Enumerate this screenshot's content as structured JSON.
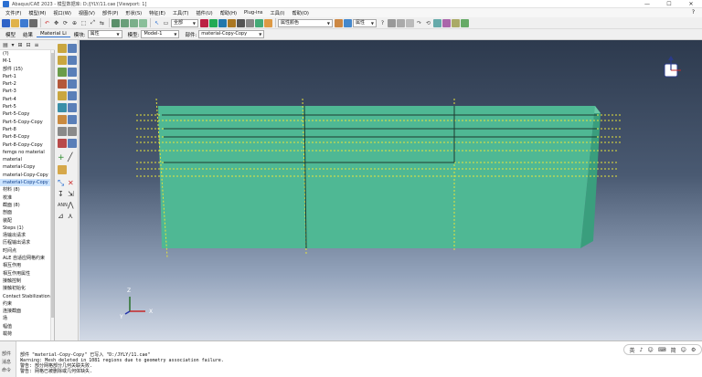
{
  "window": {
    "title": "Abaqus/CAE 2023 - 模型数据库: D:/JYLY/11.cae [Viewport: 1]",
    "controls": [
      "—",
      "☐",
      "✕"
    ]
  },
  "menubar": {
    "items": [
      "文件(F)",
      "模型(M)",
      "视口(W)",
      "视图(V)",
      "部件(P)",
      "形状(S)",
      "特征(E)",
      "工具(T)",
      "插件(U)",
      "帮助(H)",
      "Plug-ins",
      "工具(I)",
      "帮助(O)"
    ],
    "submenu_indicator": "?"
  },
  "toolbar1": {
    "render_combo": "全部",
    "render_combo2": "属性颜色",
    "combo3": "属性"
  },
  "toolbar2": {
    "tabs": [
      "模型",
      "结果",
      "Material Li"
    ],
    "module_label": "模块:",
    "module_value": "属性",
    "model_label": "模型:",
    "model_value": "Model-1",
    "part_label": "部件:",
    "part_value": "material-Copy-Copy"
  },
  "tree": {
    "root": "(?)",
    "model": "M-1",
    "items": [
      "部件 (15)",
      "Part-1",
      "Part-2",
      "Part-3",
      "Part-4",
      "Part-5",
      "Part-5-Copy",
      "Part-5-Copy-Copy",
      "Part-8",
      "Part-8-Copy",
      "Part-8-Copy-Copy",
      "femgs no material",
      "material",
      "material-Copy",
      "material-Copy-Copy",
      "material-Copy-Copy",
      "材料 (8)",
      "校准",
      "截面 (8)",
      "剖面",
      "装配",
      "Steps (1)",
      "场输出请求",
      "历程输出请求",
      "时间点",
      "ALE 自适应网格约束",
      "相互作用",
      "相互作用属性",
      "接触控制",
      "接触初始化",
      "Contact Stabilization",
      "约束",
      "连接截面",
      "场",
      "幅值",
      "载荷"
    ],
    "selected_index": 15
  },
  "messages": {
    "side_labels": [
      "部件",
      "消息",
      "命令"
    ],
    "lines": [
      "部件 \"material-Copy-Copy\" 已写入 \"D:/JYLY/11.cae\"",
      "Warning: Mesh deleted in 1081 regions due to geometry association failure.",
      "警告: 部分网格部分几何关联失败.",
      "警告: 网格已被删除或几何体缺失."
    ]
  },
  "ime": {
    "items": [
      "英",
      "♪",
      "☺",
      "⌨",
      "简",
      "☺",
      "⚙"
    ]
  },
  "triad": {
    "x": "X",
    "y": "Y",
    "z": "Z"
  },
  "colors": {
    "part_fill": "#4fb894",
    "part_top": "#6cc9a7",
    "part_side": "#3a9e7d",
    "mesh_lines": "#e8e33a",
    "selection_blue": "#cce4ff"
  }
}
